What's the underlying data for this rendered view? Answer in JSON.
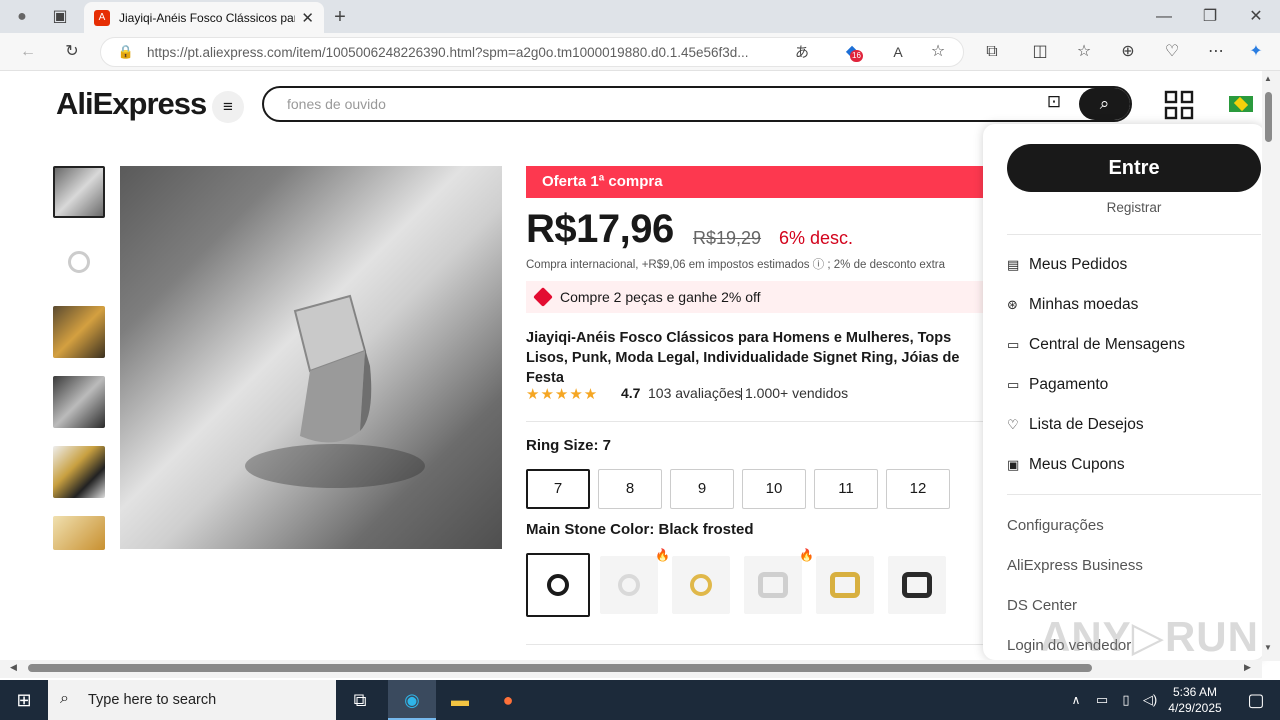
{
  "browser": {
    "tab_title": "Jiayiqi-Anéis Fosco Clássicos par",
    "url": "https://pt.aliexpress.com/item/1005006248226390.html?spm=a2g0o.tm1000019880.d0.1.45e56f3d...",
    "notif_count": "16"
  },
  "header": {
    "logo": "AliExpress",
    "search_placeholder": "fones de ouvido"
  },
  "product": {
    "offer_banner": "Oferta 1ª compra",
    "price": "R$17,96",
    "old_price": "R$19,29",
    "discount": "6% desc.",
    "tax_note": "Compra internacional, +R$9,06 em impostos estimados ⓘ ; 2% de desconto extra",
    "promo": "Compre 2 peças e ganhe 2% off",
    "title": "Jiayiqi-Anéis Fosco Clássicos para Homens e Mulheres, Tops Lisos, Punk, Moda Legal, Individualidade Signet Ring, Jóias de Festa",
    "rating": "4.7",
    "reviews": "103 avaliações",
    "sold": "1.000+ vendidos",
    "stars": "★★★★★",
    "size_label": "Ring Size: 7",
    "sizes": [
      "7",
      "8",
      "9",
      "10",
      "11",
      "12"
    ],
    "color_label": "Main Stone Color: Black frosted",
    "swatch_colors": [
      "#1a1a1a",
      "#d9d9d9",
      "#e0b84a",
      "#cfcfcf",
      "#d8b040",
      "#2a2a2a"
    ]
  },
  "account_menu": {
    "login": "Entre",
    "register": "Registrar",
    "items": [
      "Meus Pedidos",
      "Minhas moedas",
      "Central de Mensagens",
      "Pagamento",
      "Lista de Desejos",
      "Meus Cupons"
    ],
    "links": [
      "Configurações",
      "AliExpress Business",
      "DS Center",
      "Login do vendedor"
    ]
  },
  "watermark": "ANY▷RUN",
  "taskbar": {
    "search_placeholder": "Type here to search",
    "time": "5:36 AM",
    "date": "4/29/2025"
  }
}
